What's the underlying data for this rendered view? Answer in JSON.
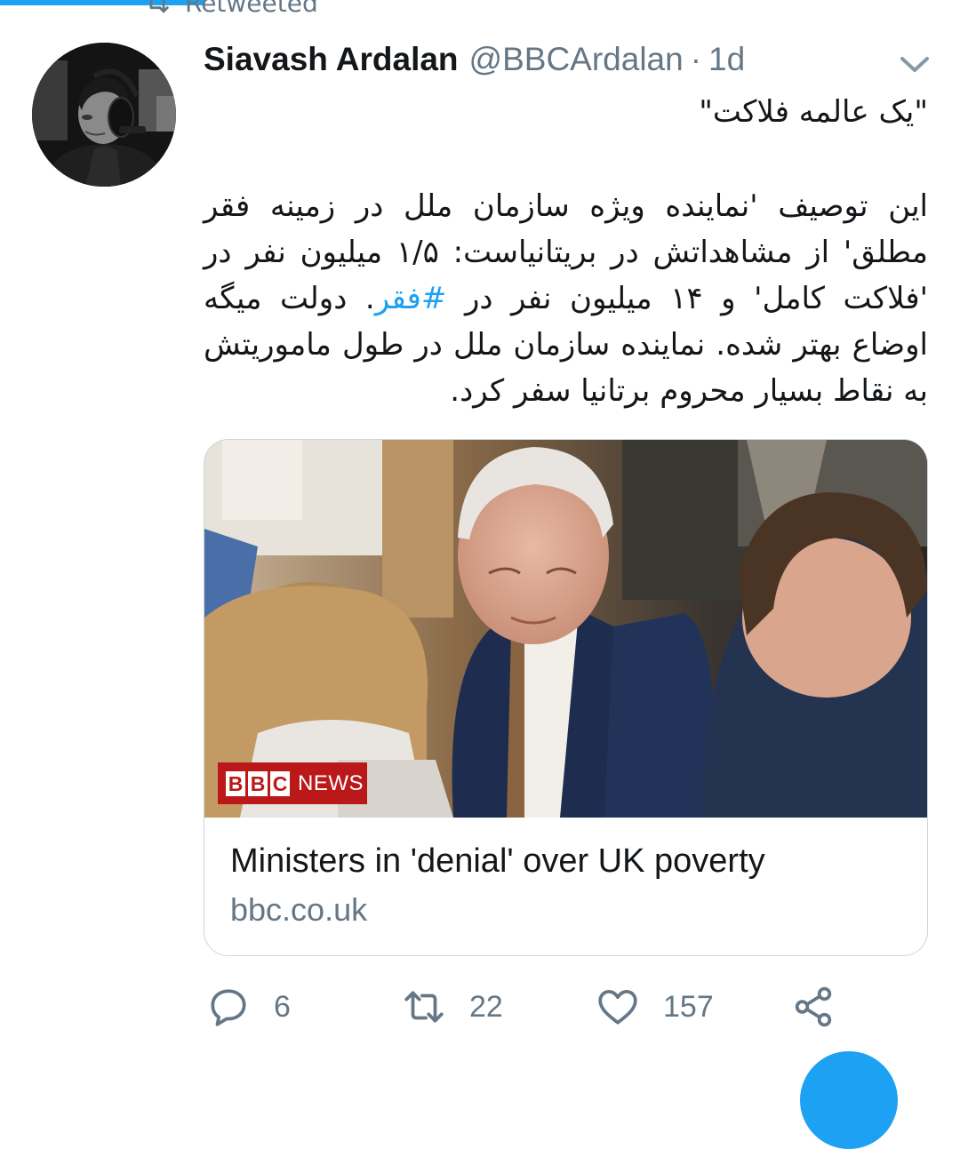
{
  "retweet": {
    "label": "Retweeted",
    "icon": "retweet-icon"
  },
  "author": {
    "name": "Siavash Ardalan",
    "handle": "@BBCArdalan",
    "separator": "·",
    "time": "1d"
  },
  "tweet": {
    "title": "\"یک عالمه فلاکت\"",
    "body_before_hashtag": "این توصیف 'نماینده ویژه سازمان ملل در زمینه فقر مطلق' از مشاهداتش در بریتانیاست: ۱/۵ میلیون نفر در 'فلاکت کامل' و ۱۴ میلیون نفر در ",
    "hashtag": "#فقر",
    "body_after_hashtag": ". دولت میگه اوضاع بهتر شده. نماینده سازمان ملل در طول ماموریتش به نقاط بسیار محروم برتانیا سفر کرد."
  },
  "card": {
    "badge_letters": [
      "B",
      "B",
      "C"
    ],
    "badge_word": "NEWS",
    "title": "Ministers in 'denial' over UK poverty",
    "domain": "bbc.co.uk"
  },
  "actions": {
    "reply_count": "6",
    "retweet_count": "22",
    "like_count": "157"
  },
  "colors": {
    "accent": "#1da1f2",
    "secondary_text": "#657786",
    "bbc_red": "#bb1919",
    "border": "#ccd6dd"
  }
}
